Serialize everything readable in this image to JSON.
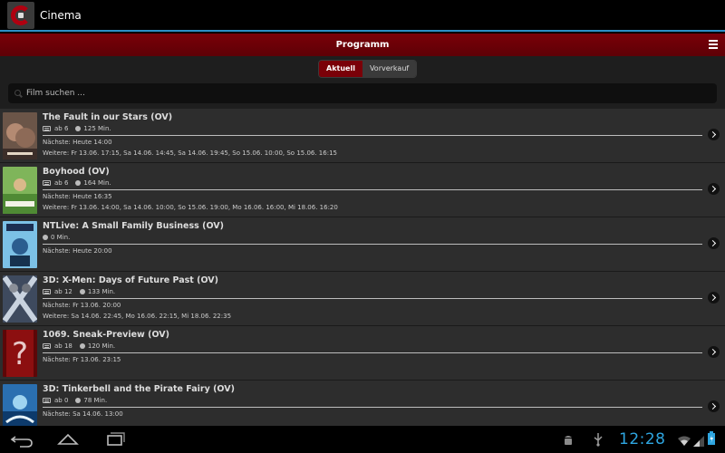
{
  "app": {
    "title": "Cinema"
  },
  "actionbar": {
    "title": "Programm"
  },
  "tabs": [
    {
      "label": "Aktuell",
      "active": true
    },
    {
      "label": "Vorverkauf",
      "active": false
    }
  ],
  "search": {
    "placeholder": "Film suchen ..."
  },
  "movies": [
    {
      "title": "The Fault in our Stars (OV)",
      "fsk": "ab 6",
      "duration": "125 Min.",
      "next": "Nächste: Heute 14:00",
      "further": "Weitere: Fr 13.06. 17:15, Sa 14.06. 14:45, Sa 14.06. 19:45, So 15.06. 10:00, So 15.06. 16:15"
    },
    {
      "title": "Boyhood (OV)",
      "fsk": "ab 6",
      "duration": "164 Min.",
      "next": "Nächste: Heute 16:35",
      "further": "Weitere: Fr 13.06. 14:00, Sa 14.06. 10:00, So 15.06. 19:00, Mo 16.06. 16:00, Mi 18.06. 16:20"
    },
    {
      "title": "NTLive: A Small Family Business (OV)",
      "fsk": "",
      "duration": "0 Min.",
      "next": "Nächste: Heute 20:00",
      "further": ""
    },
    {
      "title": "3D: X-Men: Days of Future Past (OV)",
      "fsk": "ab 12",
      "duration": "133 Min.",
      "next": "Nächste: Fr 13.06. 20:00",
      "further": "Weitere: Sa 14.06. 22:45, Mo 16.06. 22:15, Mi 18.06. 22:35"
    },
    {
      "title": "1069. Sneak-Preview (OV)",
      "fsk": "ab 18",
      "duration": "120 Min.",
      "next": "Nächste: Fr 13.06. 23:15",
      "further": ""
    },
    {
      "title": "3D: Tinkerbell and the Pirate Fairy (OV)",
      "fsk": "ab 0",
      "duration": "78 Min.",
      "next": "Nächste: Sa 14.06. 13:00",
      "further": ""
    }
  ],
  "statusbar": {
    "time": "12:28"
  },
  "icons": {
    "app": "cinema-logo-icon",
    "menu": "hamburger-menu-icon",
    "search": "search-icon",
    "fsk": "film-rating-icon",
    "duration": "clock-icon",
    "chevron": "chevron-right-icon",
    "nav": [
      "back-icon",
      "home-icon",
      "recent-apps-icon"
    ],
    "status": [
      "android-debug-icon",
      "usb-icon",
      "wifi-icon",
      "signal-icon",
      "battery-icon"
    ]
  },
  "colors": {
    "accent_red": "#7a0008",
    "holo_blue": "#2ea5e0",
    "row_bg": "#2d2d2d"
  }
}
